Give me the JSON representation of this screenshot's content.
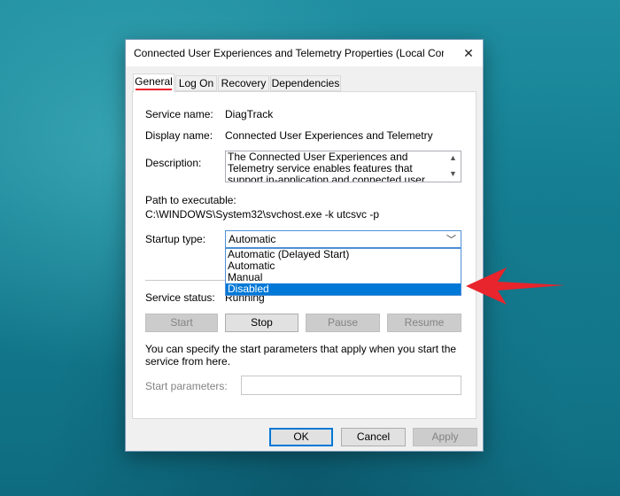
{
  "window": {
    "title": "Connected User Experiences and Telemetry Properties (Local Comp...",
    "close_glyph": "✕"
  },
  "tabs": [
    {
      "label": "General",
      "active": true
    },
    {
      "label": "Log On",
      "active": false
    },
    {
      "label": "Recovery",
      "active": false
    },
    {
      "label": "Dependencies",
      "active": false
    }
  ],
  "general": {
    "service_name_label": "Service name:",
    "service_name": "DiagTrack",
    "display_name_label": "Display name:",
    "display_name": "Connected User Experiences and Telemetry",
    "description_label": "Description:",
    "description": "The Connected User Experiences and Telemetry service enables features that support in-application and connected user experiences. Additionally, this",
    "path_label": "Path to executable:",
    "path": "C:\\WINDOWS\\System32\\svchost.exe -k utcsvc -p",
    "startup_type_label": "Startup type:",
    "startup_type_value": "Automatic",
    "startup_options": [
      "Automatic (Delayed Start)",
      "Automatic",
      "Manual",
      "Disabled"
    ],
    "highlighted_option": "Disabled",
    "service_status_label": "Service status:",
    "service_status": "Running",
    "buttons": {
      "start": "Start",
      "stop": "Stop",
      "pause": "Pause",
      "resume": "Resume"
    },
    "help_text": "You can specify the start parameters that apply when you start the service from here.",
    "start_params_label": "Start parameters:",
    "start_params_value": ""
  },
  "footer": {
    "ok": "OK",
    "cancel": "Cancel",
    "apply": "Apply"
  },
  "colors": {
    "accent": "#0078d7",
    "annotation_red": "#e8242c"
  }
}
